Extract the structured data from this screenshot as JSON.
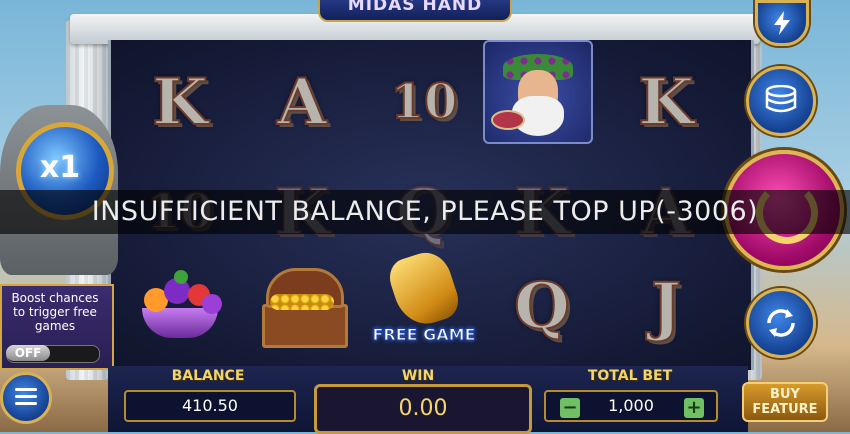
{
  "game": {
    "title": "MIDAS HAND"
  },
  "reels": {
    "row1": [
      "K",
      "A",
      "10",
      "",
      "K"
    ],
    "row2": [
      "10",
      "K",
      "Q",
      "K",
      "A"
    ],
    "row3": [
      "",
      "",
      "",
      "Q",
      "J"
    ],
    "free_game_label": "FREE GAME"
  },
  "message": "INSUFFICIENT BALANCE, PLEASE TOP UP(-3006)",
  "multiplier": "x1",
  "boost": {
    "text": "Boost chances to trigger free games",
    "toggle": "OFF"
  },
  "panel": {
    "balance_label": "BALANCE",
    "balance_value": "410.50",
    "win_label": "WIN",
    "win_value": "0.00",
    "total_bet_label": "TOTAL BET",
    "total_bet_value": "1,000",
    "minus": "−",
    "plus": "+",
    "buy_feature": "BUY FEATURE"
  },
  "icons": [
    "lightning-icon",
    "coin-stack-icon",
    "spin-icon",
    "autoplay-icon",
    "menu-icon"
  ],
  "colors": {
    "accent_gold": "#d9b253",
    "spin_pink": "#ff4fb4",
    "button_blue": "#3f86e8",
    "win_text": "#f5d66b"
  }
}
